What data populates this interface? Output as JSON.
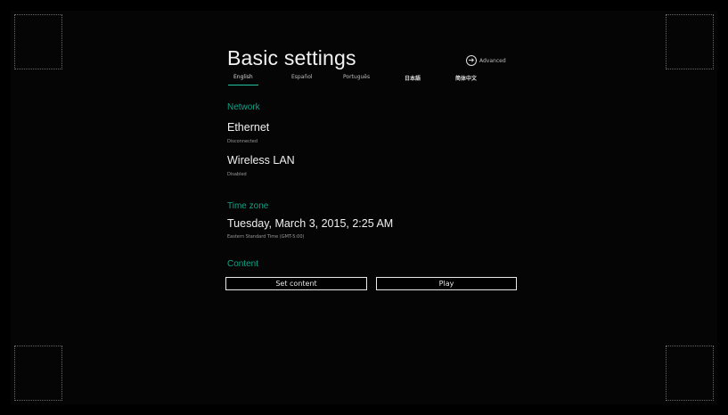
{
  "title": "Basic settings",
  "advanced_label": "Advanced",
  "languages": [
    "English",
    "Español",
    "Português",
    "日本語",
    "简体中文"
  ],
  "network": {
    "heading": "Network",
    "ethernet": {
      "label": "Ethernet",
      "status": "Disconnected"
    },
    "wireless": {
      "label": "Wireless LAN",
      "status": "Disabled"
    }
  },
  "timezone": {
    "heading": "Time zone",
    "datetime": "Tuesday, March 3, 2015, 2:25 AM",
    "zone": "Eastern Standard Time (GMT-5:00)"
  },
  "content": {
    "heading": "Content",
    "set_content": "Set content",
    "play": "Play"
  },
  "colors": {
    "accent": "#14a085",
    "tab_underline": "#23c4a2"
  }
}
